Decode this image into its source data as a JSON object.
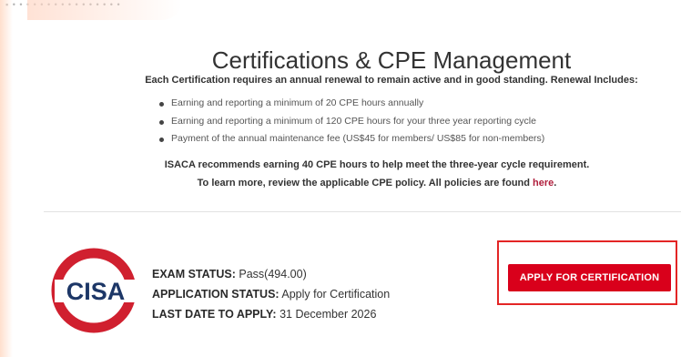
{
  "topbar": {
    "text": "▪ • • • • • • • • • • • • • • • •"
  },
  "page": {
    "title": "Certifications & CPE Management",
    "subtitle": "Each Certification requires an annual renewal to remain active and in good standing. Renewal Includes:",
    "bullets": [
      "Earning and reporting a minimum of 20 CPE hours annually",
      "Earning and reporting a minimum of 120 CPE hours for your three year reporting cycle",
      "Payment of the annual maintenance fee (US$45 for members/ US$85 for non-members)"
    ],
    "recommend_line1": "ISACA recommends earning 40 CPE hours to help meet the three-year cycle requirement.",
    "recommend_line2_prefix": "To learn more, review the applicable CPE policy. All policies are found ",
    "recommend_link": "here",
    "recommend_line2_suffix": "."
  },
  "certification": {
    "logo_text": "CISA",
    "exam_status_label": "EXAM STATUS:",
    "exam_status_value": "Pass(494.00)",
    "application_status_label": "APPLICATION STATUS:",
    "application_status_value": "Apply for Certification",
    "last_date_label": "LAST DATE TO APPLY:",
    "last_date_value": "31 December 2026",
    "apply_button_label": "APPLY FOR CERTIFICATION"
  },
  "colors": {
    "brand_red": "#d9001b",
    "highlight_red": "#e32525",
    "logo_red": "#d0202f",
    "logo_navy": "#1d3767",
    "link": "#b01e3c"
  },
  "icons": {
    "bullet": "bullet-dot-icon",
    "logo": "cisa-logo"
  }
}
